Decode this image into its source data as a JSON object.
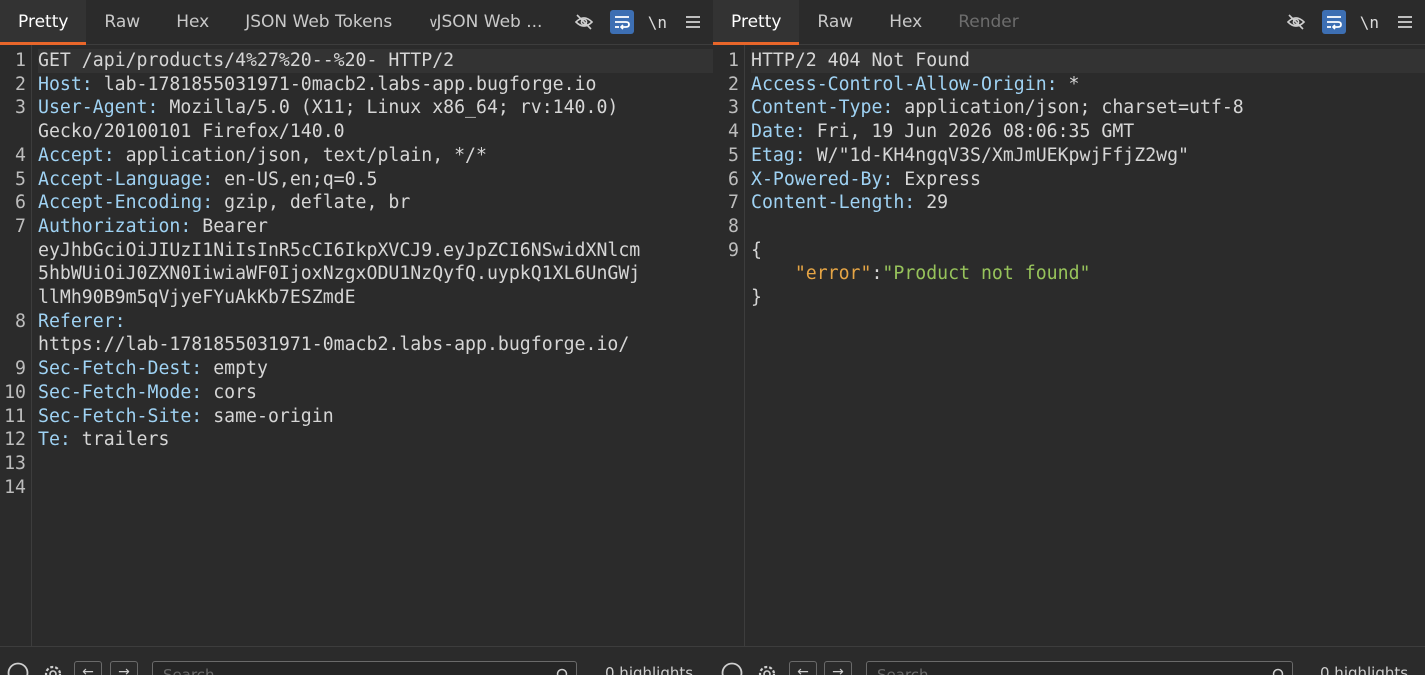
{
  "request": {
    "tabs": [
      {
        "label": "Pretty",
        "state": "active"
      },
      {
        "label": "Raw",
        "state": "normal"
      },
      {
        "label": "Hex",
        "state": "normal"
      },
      {
        "label": "JSON Web Tokens",
        "state": "normal"
      },
      {
        "label": "JSON Web ...",
        "state": "dropdown"
      }
    ],
    "lines": [
      {
        "n": "1",
        "key": "",
        "val": "GET /api/products/4%27%20--%20- HTTP/2",
        "hl": true
      },
      {
        "n": "2",
        "key": "Host:",
        "val": " lab-1781855031971-0macb2.labs-app.bugforge.io"
      },
      {
        "n": "3",
        "key": "User-Agent:",
        "val": " Mozilla/5.0 (X11; Linux x86_64; rv:140.0)",
        "cont": [
          "Gecko/20100101 Firefox/140.0"
        ]
      },
      {
        "n": "4",
        "key": "Accept:",
        "val": " application/json, text/plain, */*"
      },
      {
        "n": "5",
        "key": "Accept-Language:",
        "val": " en-US,en;q=0.5"
      },
      {
        "n": "6",
        "key": "Accept-Encoding:",
        "val": " gzip, deflate, br"
      },
      {
        "n": "7",
        "key": "Authorization:",
        "val": " Bearer",
        "cont": [
          "eyJhbGciOiJIUzI1NiIsInR5cCI6IkpXVCJ9.eyJpZCI6NSwidXNlcm",
          "5hbWUiOiJ0ZXN0IiwiaWF0IjoxNzgxODU1NzQyfQ.uypkQ1XL6UnGWj",
          "llMh90B9m5qVjyeFYuAkKb7ESZmdE"
        ]
      },
      {
        "n": "8",
        "key": "Referer:",
        "val": "",
        "cont": [
          "https://lab-1781855031971-0macb2.labs-app.bugforge.io/"
        ]
      },
      {
        "n": "9",
        "key": "Sec-Fetch-Dest:",
        "val": " empty"
      },
      {
        "n": "10",
        "key": "Sec-Fetch-Mode:",
        "val": " cors"
      },
      {
        "n": "11",
        "key": "Sec-Fetch-Site:",
        "val": " same-origin"
      },
      {
        "n": "12",
        "key": "Te:",
        "val": " trailers"
      },
      {
        "n": "13",
        "key": "",
        "val": ""
      },
      {
        "n": "14",
        "key": "",
        "val": ""
      }
    ],
    "search": {
      "placeholder": "Search",
      "highlights": "0 highlights"
    }
  },
  "response": {
    "tabs": [
      {
        "label": "Pretty",
        "state": "active"
      },
      {
        "label": "Raw",
        "state": "normal"
      },
      {
        "label": "Hex",
        "state": "normal"
      },
      {
        "label": "Render",
        "state": "disabled"
      }
    ],
    "lines": [
      {
        "n": "1",
        "key": "",
        "val": "HTTP/2 404 Not Found",
        "hl": true
      },
      {
        "n": "2",
        "key": "Access-Control-Allow-Origin:",
        "val": " *"
      },
      {
        "n": "3",
        "key": "Content-Type:",
        "val": " application/json; charset=utf-8"
      },
      {
        "n": "4",
        "key": "Date:",
        "val": " Fri, 19 Jun 2026 08:06:35 GMT"
      },
      {
        "n": "5",
        "key": "Etag:",
        "val": " W/\"1d-KH4ngqV3S/XmJmUEKpwjFfjZ2wg\""
      },
      {
        "n": "6",
        "key": "X-Powered-By:",
        "val": " Express"
      },
      {
        "n": "7",
        "key": "Content-Length:",
        "val": " 29"
      },
      {
        "n": "8",
        "key": "",
        "val": ""
      },
      {
        "n": "9",
        "key": "",
        "val": "{"
      },
      {
        "n": "",
        "key": "",
        "val": "",
        "json_key": "\"error\"",
        "json_colon": ":",
        "json_val": "\"Product not found\""
      },
      {
        "n": "",
        "key": "",
        "val": "}"
      }
    ],
    "search": {
      "placeholder": "Search",
      "highlights": "0 highlights"
    }
  },
  "toolbar": {
    "hide_icon": "eye-slash-icon",
    "wrap_icon": "wrap-lines-icon",
    "newline_label": "\\n",
    "menu_icon": "hamburger-menu-icon"
  },
  "colors": {
    "accent": "#e8662a",
    "header_key": "#9fd2f3",
    "json_key": "#e6a545",
    "json_string": "#97c35b",
    "toggle_on": "#3d6fb3"
  }
}
